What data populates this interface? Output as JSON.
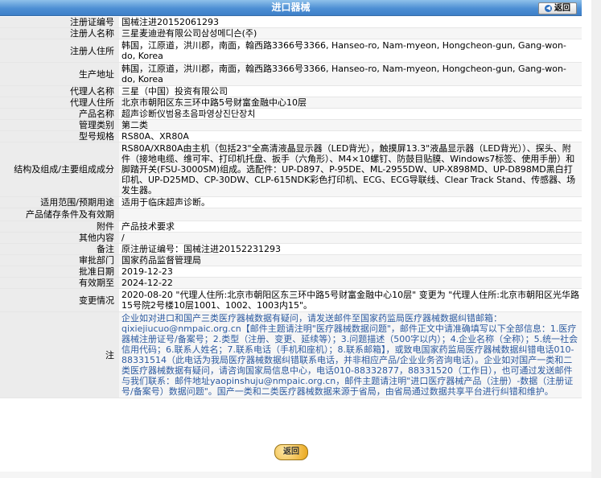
{
  "header": {
    "title": "进口器械",
    "back_label": "返回"
  },
  "rows": [
    {
      "label": "注册证编号",
      "value": "国械注进20152061293"
    },
    {
      "label": "注册人名称",
      "value": "三星麦迪逊有限公司삼성메디슨(주)"
    },
    {
      "label": "注册人住所",
      "value": "韩国，江原道，洪川郡，南面，翰西路3366号3366, Hanseo-ro, Nam-myeon, Hongcheon-gun, Gang-won-do, Korea"
    },
    {
      "label": "生产地址",
      "value": "韩国，江原道，洪川郡，南面，翰西路3366号3366, Hanseo-ro, Nam-myeon, Hongcheon-gun, Gang-won-do, Korea"
    },
    {
      "label": "代理人名称",
      "value": "三星（中国）投资有限公司"
    },
    {
      "label": "代理人住所",
      "value": "北京市朝阳区东三环中路5号财富金融中心10层"
    },
    {
      "label": "产品名称",
      "value": "超声诊断仪범용초음파영상진단장치"
    },
    {
      "label": "管理类别",
      "value": "第二类"
    },
    {
      "label": "型号规格",
      "value": "RS80A、XR80A"
    },
    {
      "label": "结构及组成/主要组成成分",
      "value": "RS80A/XR80A由主机（包括23\"全高清液晶显示器（LED背光），触摸屏13.3\"液晶显示器（LED背光））、探头、附件（接地电缆、维可牢、打印机托盘、扳手（六角形）、M4×10螺钉、防鼓目贴膜、Windows7标签、使用手册）和脚踏开关(FSU-3000SM)组成。选配件：UP-D897、P-95DE、ML-2955DW、UP-X898MD、UP-D898MD黑白打印机、UP-D25MD、CP-30DW、CLP-615NDK彩色打印机、ECG、ECG导联线、Clear Track Stand、传感器、场发生器。"
    },
    {
      "label": "适用范围/预期用途",
      "value": "适用于临床超声诊断。"
    },
    {
      "label": "产品储存条件及有效期",
      "value": ""
    },
    {
      "label": "附件",
      "value": "产品技术要求"
    },
    {
      "label": "其他内容",
      "value": "/"
    },
    {
      "label": "备注",
      "value": "原注册证编号：国械注进20152231293"
    },
    {
      "label": "审批部门",
      "value": "国家药品监督管理局"
    },
    {
      "label": "批准日期",
      "value": "2019-12-23"
    },
    {
      "label": "有效期至",
      "value": "2024-12-22"
    },
    {
      "label": "变更情况",
      "value": "2020-08-20 \"代理人住所:北京市朝阳区东三环中路5号财富金融中心10层\" 变更为 \"代理人住所:北京市朝阳区光华路15号院2号楼10层1001、1002、1003内15\"。"
    },
    {
      "label": "注",
      "value": "企业如对进口和国产三类医疗器械数据有疑问，请发送邮件至国家药监局医疗器械数据纠错邮箱：qixiejiucuo@nmpaic.org.cn【邮件主题请注明\"医疗器械数据问题\"，邮件正文中请准确填写以下全部信息：1.医疗器械注册证号/备案号；2.类型（注册、变更、延续等）；3.问题描述（500字以内）；4.企业名称（全称）；5.统一社会信用代码；6.联系人姓名；7.联系电话（手机和座机）；8.联系邮箱】，或致电国家药监局医疗器械数据纠错电话010-88331514（此电话为我局医疗器械数据纠错联系电话，并非相应产品/企业业务咨询电话）。企业如对国产一类和二类医疗器械数据有疑问，请咨询国家局信息中心，电话010-88332877，88331520（工作日），也可通过发送邮件与我们联系：邮件地址yaopinshuju@nmpaic.org.cn，邮件主题请注明\"进口医疗器械产品（注册）-数据（注册证号/备案号）数据问题\"。国产一类和二类医疗器械数据来源于省局，由省局通过数据共享平台进行纠错和维护。"
    }
  ],
  "footer": {
    "back_label": "返回"
  }
}
